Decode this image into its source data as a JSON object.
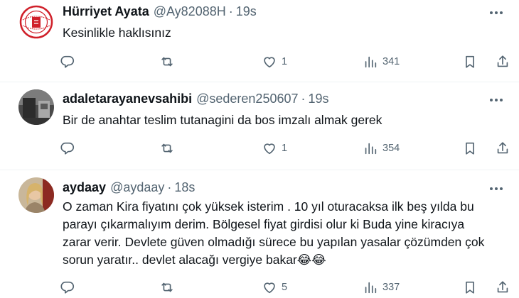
{
  "tweets": [
    {
      "name": "Hürriyet Ayata",
      "handle": "@Ay82088H",
      "separator": "·",
      "time": "19s",
      "text": "Kesinlikle haklısınız",
      "replies": "",
      "retweets": "",
      "likes": "1",
      "views": "341"
    },
    {
      "name": "adaletarayanevsahibi",
      "handle": "@sederen250607",
      "separator": "·",
      "time": "19s",
      "text": "Bir de anahtar teslim tutanagini da bos imzalı almak gerek",
      "replies": "",
      "retweets": "",
      "likes": "1",
      "views": "354"
    },
    {
      "name": "aydaay",
      "handle": "@aydaay",
      "separator": "·",
      "time": "18s",
      "text_lines": [
        "O zaman Kira fiyatını çok yüksek isterim . 10 yıl oturacaksa ilk beş yılda bu",
        "parayı çıkarmalıyım derim. Bölgesel fiyat girdisi olur ki Buda yine kiracıya",
        "zarar verir. Devlete güven olmadığı sürece bu yapılan yasalar çözümden çok",
        "sorun yaratır.. devlet alacağı vergiye bakar😂😂"
      ],
      "replies": "",
      "retweets": "",
      "likes": "5",
      "views": "337"
    }
  ],
  "icons": {
    "more": "more-horizontal-icon",
    "reply": "reply-icon",
    "retweet": "retweet-icon",
    "like": "heart-icon",
    "views": "views-icon",
    "bookmark": "bookmark-icon",
    "share": "share-icon"
  },
  "colors": {
    "text": "#0f1419",
    "secondary": "#536471",
    "divider": "#eff3f4",
    "avatar0_accent": "#d0202a"
  }
}
